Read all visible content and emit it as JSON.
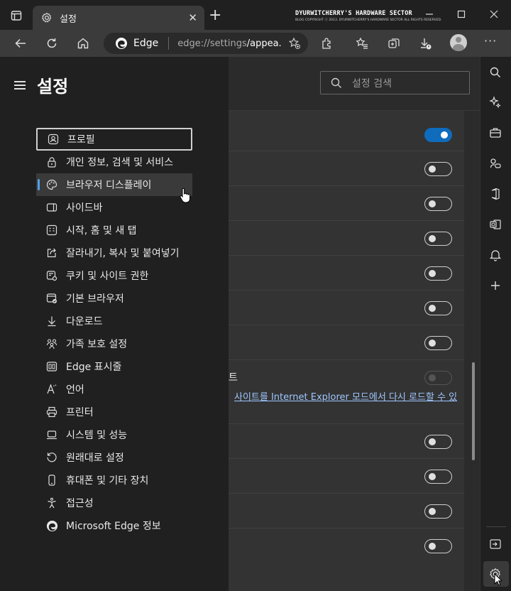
{
  "browser": {
    "tab_title": "설정",
    "address_label": "Edge",
    "url_host": "edge://settings",
    "url_path": "/appea...",
    "watermark_title": "DYURWITCHERRY'S HARDWARE SECTOR",
    "watermark_sub": "BLOG COPYRIGHT ⓒ 2013. DYURWITCHERRY'S HARDWARE SECTOR ALL RIGHTS RESERVED."
  },
  "settings": {
    "title": "설정",
    "search_placeholder": "설정 검색",
    "nav": [
      {
        "label": "프로필",
        "icon": "profile-icon"
      },
      {
        "label": "개인 정보, 검색 및 서비스",
        "icon": "lock-icon"
      },
      {
        "label": "브라우저 디스플레이",
        "icon": "palette-icon"
      },
      {
        "label": "사이드바",
        "icon": "sidebar-icon"
      },
      {
        "label": "시작, 홈 및 새 탭",
        "icon": "start-icon"
      },
      {
        "label": "잘라내기, 복사 및 붙여넣기",
        "icon": "share-icon"
      },
      {
        "label": "쿠키 및 사이트 권한",
        "icon": "cookie-icon"
      },
      {
        "label": "기본 브라우저",
        "icon": "default-browser-icon"
      },
      {
        "label": "다운로드",
        "icon": "download-icon"
      },
      {
        "label": "가족 보호 설정",
        "icon": "family-icon"
      },
      {
        "label": "Edge 표시줄",
        "icon": "edge-bar-icon"
      },
      {
        "label": "언어",
        "icon": "language-icon"
      },
      {
        "label": "프린터",
        "icon": "printer-icon"
      },
      {
        "label": "시스템 및 성능",
        "icon": "system-icon"
      },
      {
        "label": "원래대로 설정",
        "icon": "reset-icon"
      },
      {
        "label": "휴대폰 및 기타 장치",
        "icon": "phone-icon"
      },
      {
        "label": "접근성",
        "icon": "accessibility-icon"
      },
      {
        "label": "Microsoft Edge 정보",
        "icon": "edge-logo-icon"
      }
    ],
    "focused_index": 0,
    "selected_index": 2,
    "ie_row_text": "트",
    "ie_link_text": "사이트를 Internet Explorer 모드에서 다시 로드할 수 있"
  },
  "colors": {
    "accent": "#0f6cbd",
    "nav_indicator": "#4fa0e8"
  }
}
